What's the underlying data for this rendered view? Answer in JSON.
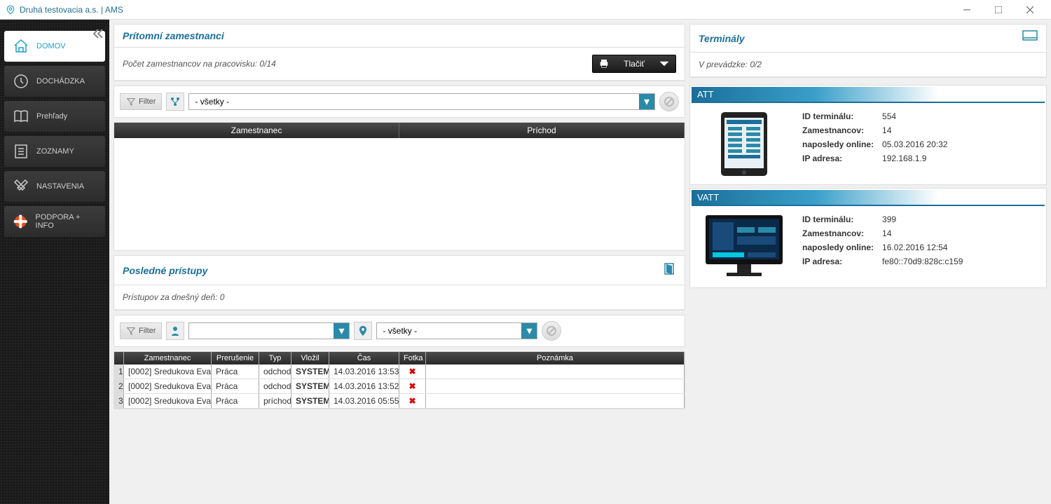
{
  "window": {
    "title": "Druhá testovacia a.s. | AMS"
  },
  "sidebar": {
    "items": [
      {
        "label": "DOMOV"
      },
      {
        "label": "DOCHÁDZKA"
      },
      {
        "label": "Prehľady"
      },
      {
        "label": "ZOZNAMY"
      },
      {
        "label": "NASTAVENIA"
      },
      {
        "label": "PODPORA + INFO"
      }
    ]
  },
  "present": {
    "title": "Prítomní zamestnanci",
    "count_label": "Počet zamestnancov na pracovisku:  0/14",
    "print_label": "Tlačiť",
    "filter_label": "Filter",
    "filter_value": "- všetky -",
    "col_employee": "Zamestnanec",
    "col_arrival": "Príchod"
  },
  "access": {
    "title": "Posledné prístupy",
    "today_label": "Prístupov za dnešný deň:  0",
    "filter_label": "Filter",
    "filter2_value": "- všetky -",
    "cols": {
      "c0": "",
      "c1": "Zamestnanec",
      "c2": "Prerušenie",
      "c3": "Typ",
      "c4": "Vložil",
      "c5": "Čas",
      "c6": "Fotka",
      "c7": "Poznámka"
    },
    "rows": [
      {
        "n": "1",
        "emp": "[0002] Sredukova Eva",
        "intr": "Práca",
        "typ": "odchod",
        "vlozil": "SYSTEM",
        "cas": "14.03.2016 13:53",
        "foto": "✖",
        "poz": ""
      },
      {
        "n": "2",
        "emp": "[0002] Sredukova Eva",
        "intr": "Práca",
        "typ": "odchod",
        "vlozil": "SYSTEM",
        "cas": "14.03.2016 13:52",
        "foto": "✖",
        "poz": ""
      },
      {
        "n": "3",
        "emp": "[0002] Sredukova Eva",
        "intr": "Práca",
        "typ": "príchod",
        "vlozil": "SYSTEM",
        "cas": "14.03.2016 05:55",
        "foto": "✖",
        "poz": ""
      }
    ]
  },
  "terminals": {
    "title": "Terminály",
    "status_label": "V prevádzke:  0/2",
    "labels": {
      "id": "ID terminálu:",
      "emp": "Zamestnancov:",
      "last": "naposledy online:",
      "ip": "IP adresa:"
    },
    "items": [
      {
        "name": "ATT",
        "id": "554",
        "emp": "14",
        "last": "05.03.2016 20:32",
        "ip": "192.168.1.9",
        "device": "tablet"
      },
      {
        "name": "VATT",
        "id": "399",
        "emp": "14",
        "last": "16.02.2016 12:54",
        "ip": "fe80::70d9:828c:c159",
        "device": "monitor"
      }
    ]
  }
}
